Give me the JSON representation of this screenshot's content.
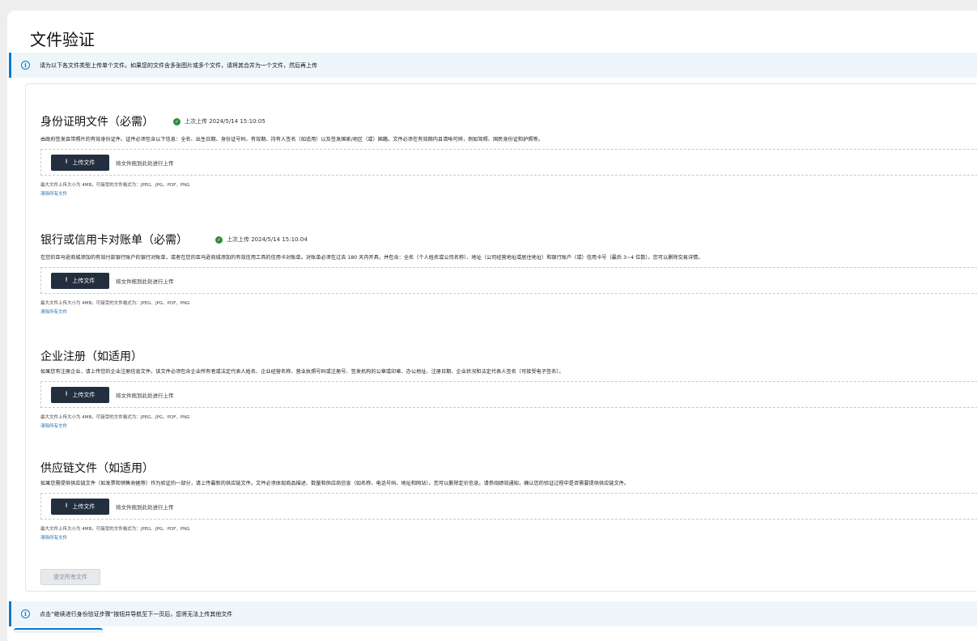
{
  "page": {
    "title": "文件验证"
  },
  "banners": {
    "top": "请为以下各文件类型上传单个文件。如果您的文件含多张图片或多个文件，请将其合并为一个文件，然后再上传",
    "bottom": "点击“继续进行身份验证步骤”按钮并导航至下一页后，您将无法上传其他文件"
  },
  "upload": {
    "button_label": "上传文件",
    "drop_text": "将文件拖到此处进行上传",
    "hint": "最大文件上传大小为 4MB。可接受的文件格式为：JPEG、JPG、PDF、PNG",
    "remove_label": "清除所有文件"
  },
  "sections": [
    {
      "title": "身份证明文件（必需）",
      "status": "上次上传 2024/5/14 15:10:05",
      "description": "由政府签发且带照片的有效身份证件。证件必须包含以下信息：全名、出生日期、身份证号码、有效期、持有人签名（如适用）以及签发国家/地区（或）国籍。文件必须在有效期内且清晰可辨，例如驾照、国民身份证和护照等。"
    },
    {
      "title": "银行或信用卡对账单（必需）",
      "status": "上次上传 2024/5/14 15:10:04",
      "description": "在您的亚马逊商城添加的有效付款银行账户的银行对账单，或者在您的亚马逊商城添加的有效信用工具的信用卡对账单。对账单必须在过去 180 天内开具，并包含：全名（个人姓名或公司名称）、地址（公司经营地址或居住地址）和银行账户（或）信用卡号（最后 3~4 位数）。您可以删除交易详情。"
    },
    {
      "title": "企业注册（如适用）",
      "status": "",
      "description": "如果您有注册企业，请上传您的企业注册信息文件。该文件必须包含企业所有者或法定代表人姓名、企业经营名称、营业执照号码或注册号、签发机构的公章或印章、办公地址、注册日期、企业状况和法定代表人签名（可接受电子签名）。"
    },
    {
      "title": "供应链文件（如适用）",
      "status": "",
      "description": "如果您需提供供应链文件（如发票和销售收据等）作为验证的一部分，请上传最新的供应链文件。文件必须体现商品描述、数量和供应商信息（如名称、电话号码、地址和网站）。您可以删除定价信息。请参阅绩效通知，确认您的验证过程中是否需要提供供应链文件。"
    }
  ],
  "submit": {
    "label": "提交所有文件"
  },
  "icons": {
    "info": "info-icon",
    "check": "check-circle-icon",
    "upload": "upload-icon"
  },
  "colors": {
    "accent": "#0b7ac9",
    "button_dark": "#232f3e",
    "success": "#2e8b3e",
    "link": "#1b6fb3"
  }
}
